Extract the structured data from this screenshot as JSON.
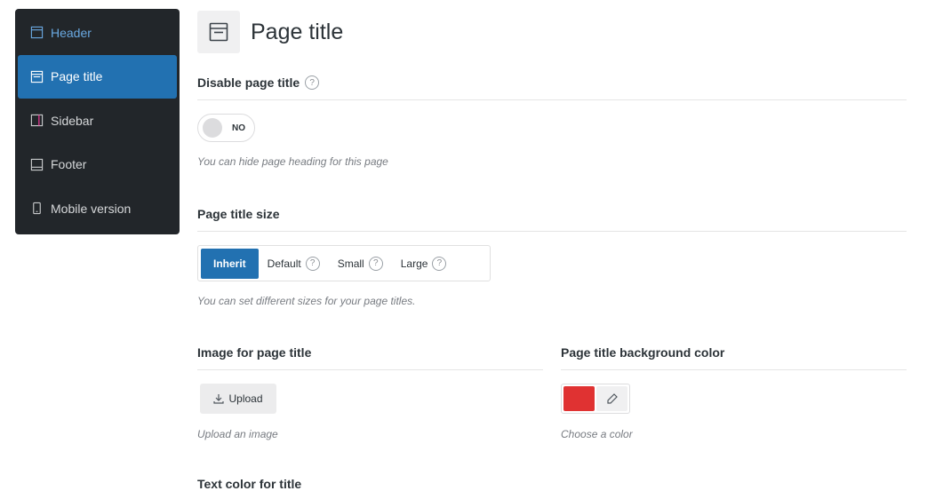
{
  "sidebar": {
    "items": [
      {
        "label": "Header",
        "icon": "header-layout-icon"
      },
      {
        "label": "Page title",
        "icon": "page-title-layout-icon"
      },
      {
        "label": "Sidebar",
        "icon": "sidebar-layout-icon"
      },
      {
        "label": "Footer",
        "icon": "footer-layout-icon"
      },
      {
        "label": "Mobile version",
        "icon": "mobile-icon"
      }
    ]
  },
  "page": {
    "title": "Page title",
    "title_icon": "page-title-layout-icon"
  },
  "disable_title": {
    "label": "Disable page title",
    "toggle_text": "NO",
    "description": "You can hide page heading for this page"
  },
  "title_size": {
    "label": "Page title size",
    "options": [
      {
        "label": "Inherit"
      },
      {
        "label": "Default"
      },
      {
        "label": "Small"
      },
      {
        "label": "Large"
      }
    ],
    "selected": "Inherit",
    "description": "You can set different sizes for your page titles."
  },
  "image": {
    "label": "Image for page title",
    "upload_label": "Upload",
    "description": "Upload an image"
  },
  "bg_color": {
    "label": "Page title background color",
    "value": "#e03232",
    "description": "Choose a color"
  },
  "next_section": {
    "label": "Text color for title"
  },
  "colors": {
    "sidebar_bg": "#22262a",
    "accent": "#2271b1",
    "header_link": "#6aa9e2"
  }
}
